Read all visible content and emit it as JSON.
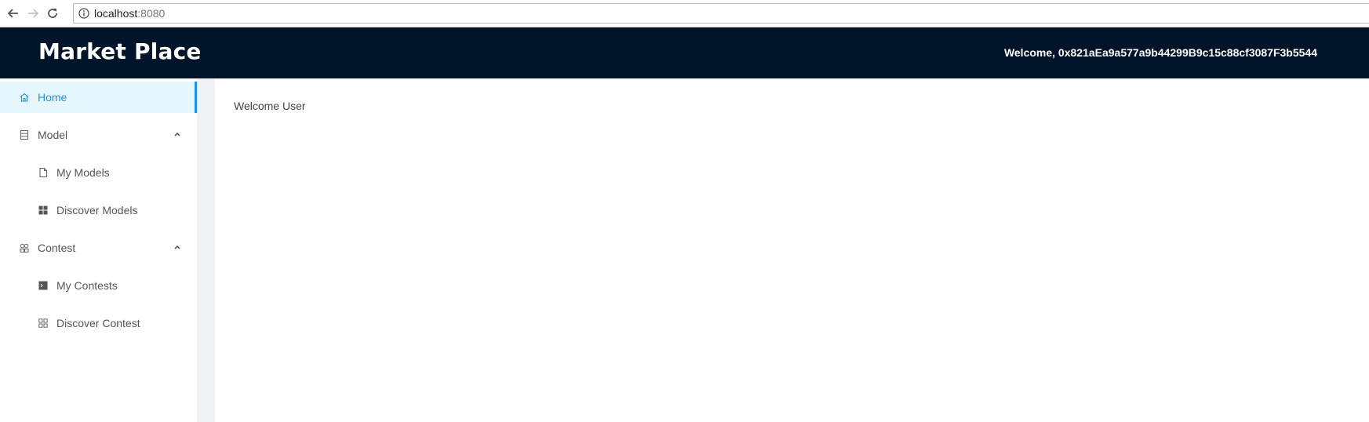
{
  "browser": {
    "url_host": "localhost",
    "url_port": ":8080"
  },
  "header": {
    "brand": "Market Place",
    "welcome": "Welcome, 0x821aEa9a577a9b44299B9c15c88cf3087F3b5544",
    "background": "#001529"
  },
  "sidebar": {
    "accent": "#1890ff",
    "items": [
      {
        "label": "Home",
        "icon": "home-icon",
        "active": true
      },
      {
        "label": "Model",
        "icon": "database-icon",
        "expanded": true
      },
      {
        "label": "My Models",
        "icon": "file-icon"
      },
      {
        "label": "Discover Models",
        "icon": "appstore-icon"
      },
      {
        "label": "Contest",
        "icon": "team-icon",
        "expanded": true
      },
      {
        "label": "My Contests",
        "icon": "code-icon"
      },
      {
        "label": "Discover Contest",
        "icon": "grid-icon"
      }
    ]
  },
  "main": {
    "text": "Welcome User"
  }
}
